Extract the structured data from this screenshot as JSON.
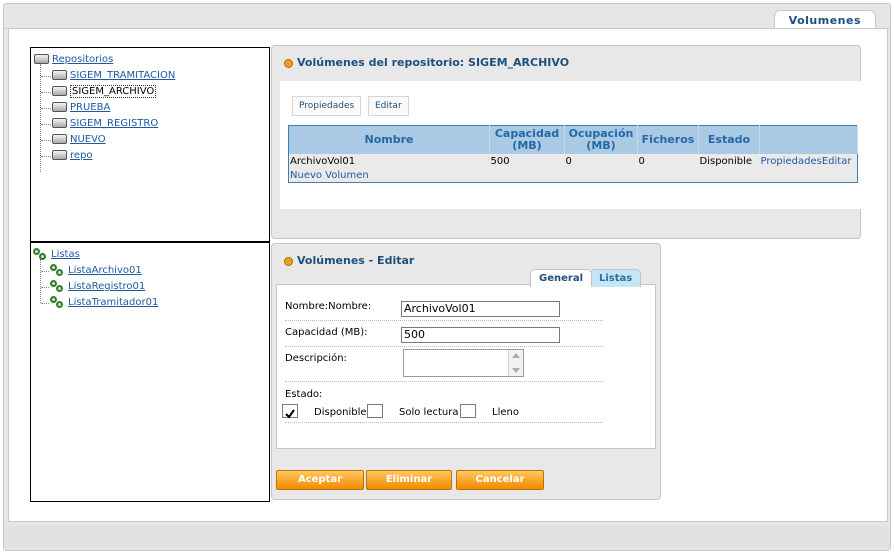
{
  "top_tab": {
    "label": "Volumenes"
  },
  "repos_tree": {
    "root": "Repositorios",
    "items": [
      "SIGEM_TRAMITACION",
      "SIGEM_ARCHIVO",
      "PRUEBA",
      "SIGEM_REGISTRO",
      "NUEVO",
      "repo"
    ],
    "selected": "SIGEM_ARCHIVO"
  },
  "lists_tree": {
    "root": "Listas",
    "items": [
      "ListaArchivo01",
      "ListaRegistro01",
      "ListaTramitador01"
    ]
  },
  "volumes_panel": {
    "title": "Volúmenes del repositorio: SIGEM_ARCHIVO",
    "buttons": {
      "properties": "Propiedades",
      "edit": "Editar"
    },
    "columns": [
      "Nombre",
      "Capacidad (MB)",
      "Ocupación (MB)",
      "Ficheros",
      "Estado",
      ""
    ],
    "rows": [
      {
        "name": "ArchivoVol01",
        "capacity": "500",
        "occupation": "0",
        "files": "0",
        "status": "Disponible",
        "action_properties": "Propiedades",
        "action_edit": "Editar"
      }
    ],
    "new_link": "Nuevo Volumen"
  },
  "edit_panel": {
    "title": "Volúmenes - Editar",
    "tabs": {
      "general": "General",
      "lists": "Listas"
    },
    "fields": {
      "name_label": "Nombre:Nombre:",
      "name_value": "ArchivoVol01",
      "capacity_label": "Capacidad (MB):",
      "capacity_value": "500",
      "description_label": "Descripción:",
      "description_value": "",
      "status_label": "Estado:"
    },
    "status_options": {
      "available": "Disponible",
      "readonly": "Solo lectura",
      "full": "Lleno"
    },
    "buttons": {
      "accept": "Aceptar",
      "delete": "Eliminar",
      "cancel": "Cancelar"
    }
  },
  "colors": {
    "accent": "#1f4f7a",
    "table_header": "#a9c9e4",
    "button_orange": "#f0a020"
  }
}
